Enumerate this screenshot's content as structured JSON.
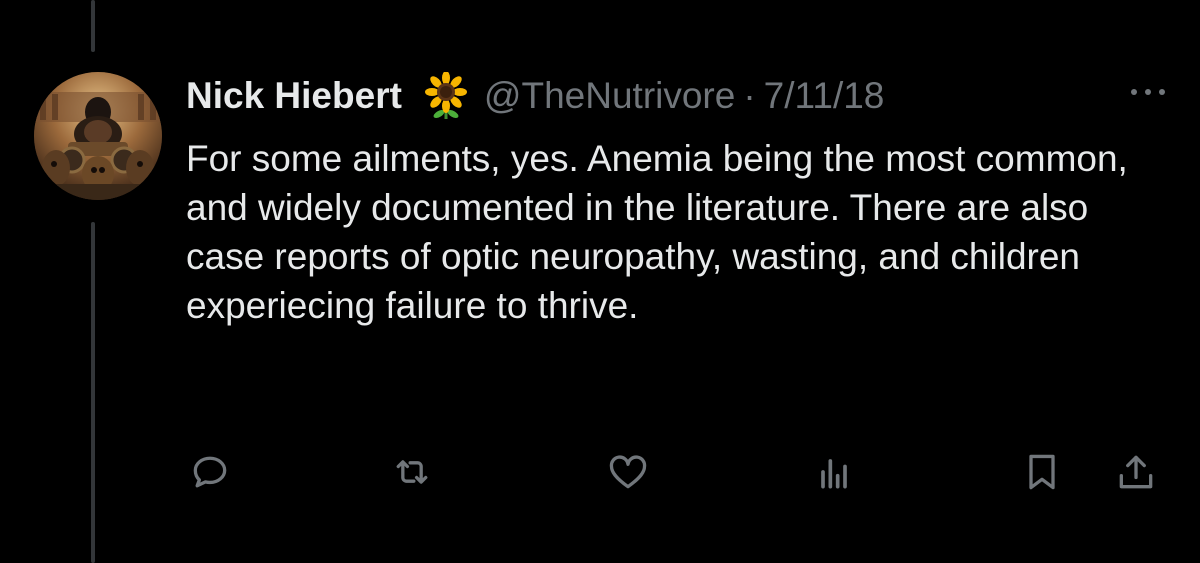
{
  "tweet": {
    "author_name": "Nick Hiebert",
    "badge_emoji": "sunflower-icon",
    "handle": "@TheNutrivore",
    "separator": "·",
    "date": "7/11/18",
    "text": "For some ailments, yes. Anemia being the most common, and widely documented in the literature. There are also case reports of optic neuropathy, wasting, and children experiecing failure to thrive."
  },
  "actions": [
    "reply-icon",
    "retweet-icon",
    "like-icon",
    "views-icon",
    "bookmark-icon",
    "share-icon"
  ],
  "colors": {
    "background": "#000000",
    "text": "#e7e9ea",
    "muted": "#71767b",
    "thread_line": "#333639"
  }
}
